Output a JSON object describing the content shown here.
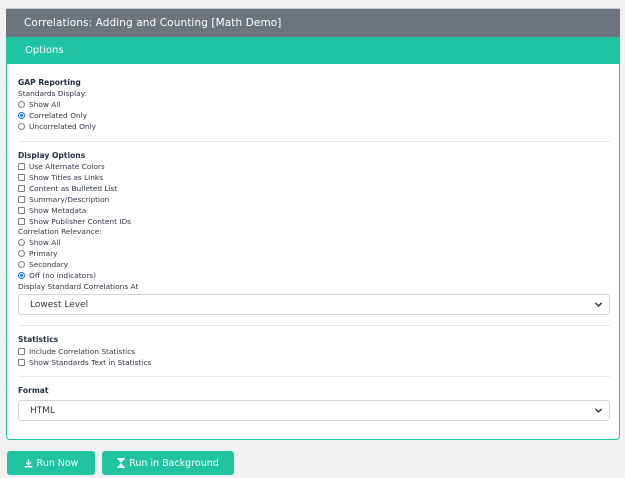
{
  "header": {
    "title": "Correlations: Adding and Counting [Math Demo]"
  },
  "panel": {
    "title": "Options"
  },
  "gap": {
    "title": "GAP Reporting",
    "standards_label": "Standards Display:",
    "options": [
      "Show All",
      "Correlated Only",
      "Uncorrelated Only"
    ],
    "selected": "Correlated Only"
  },
  "display": {
    "title": "Display Options",
    "checkboxes": [
      "Use Alternate Colors",
      "Show Titles as Links",
      "Content as Bulleted List",
      "Summary/Description",
      "Show Metadata",
      "Show Publisher Content IDs"
    ],
    "relevance_label": "Correlation Relevance:",
    "relevance_options": [
      "Show All",
      "Primary",
      "Secondary",
      "Off (no indicators)"
    ],
    "relevance_selected": "Off (no indicators)",
    "level_label": "Display Standard Correlations At",
    "level_value": "Lowest Level"
  },
  "statistics": {
    "title": "Statistics",
    "checkboxes": [
      "Include Correlation Statistics",
      "Show Standards Text in Statistics"
    ]
  },
  "format": {
    "title": "Format",
    "value": "HTML"
  },
  "buttons": {
    "run_now": "Run Now",
    "run_background": "Run in Background"
  },
  "icons": [
    "download-icon",
    "hourglass-icon",
    "chevron-down-icon"
  ],
  "colors": {
    "accent": "#20c4a0",
    "title_bar": "#6c757d",
    "radio_selected": "#1a73e8"
  }
}
